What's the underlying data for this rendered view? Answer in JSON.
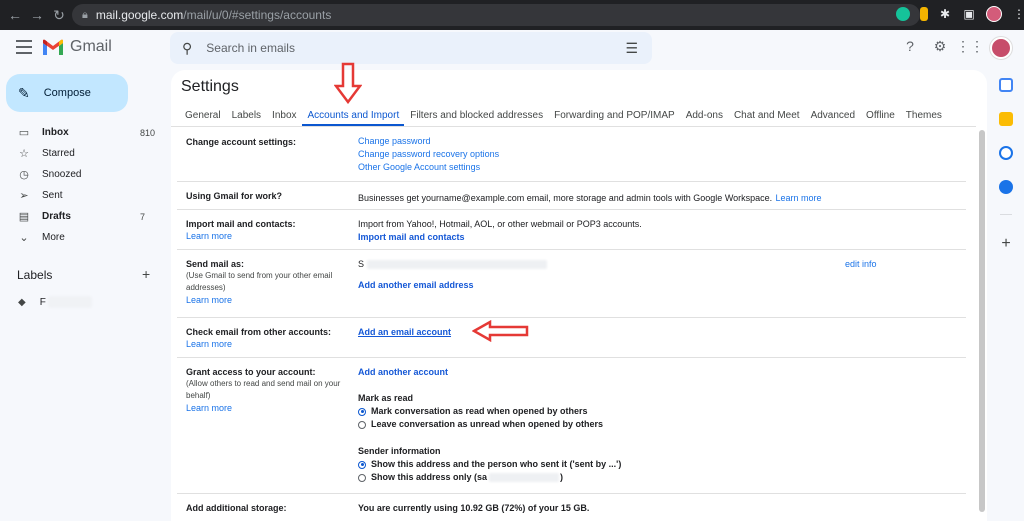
{
  "browser": {
    "url_host": "mail.google.com",
    "url_path": "/mail/u/0/#settings/accounts"
  },
  "app": {
    "name": "Gmail",
    "search_placeholder": "Search in emails"
  },
  "compose_label": "Compose",
  "nav": [
    {
      "label": "Inbox",
      "icon": "inbox-icon",
      "count": "810",
      "bold": true
    },
    {
      "label": "Starred",
      "icon": "star-icon",
      "count": ""
    },
    {
      "label": "Snoozed",
      "icon": "clock-icon",
      "count": ""
    },
    {
      "label": "Sent",
      "icon": "send-icon",
      "count": ""
    },
    {
      "label": "Drafts",
      "icon": "draft-icon",
      "count": "7",
      "bold": true
    },
    {
      "label": "More",
      "icon": "chevron-down-icon",
      "count": ""
    }
  ],
  "labels_header": "Labels",
  "label_item": "F",
  "settings": {
    "title": "Settings",
    "tabs": [
      "General",
      "Labels",
      "Inbox",
      "Accounts and Import",
      "Filters and blocked addresses",
      "Forwarding and POP/IMAP",
      "Add-ons",
      "Chat and Meet",
      "Advanced",
      "Offline",
      "Themes"
    ],
    "active_tab": "Accounts and Import",
    "rows": {
      "change_account": {
        "title": "Change account settings:",
        "links": [
          "Change password",
          "Change password recovery options",
          "Other Google Account settings"
        ]
      },
      "work": {
        "title": "Using Gmail for work?",
        "text": "Businesses get yourname@example.com email, more storage and admin tools with Google Workspace.",
        "link": "Learn more"
      },
      "import": {
        "title": "Import mail and contacts:",
        "learn": "Learn more",
        "text": "Import from Yahoo!, Hotmail, AOL, or other webmail or POP3 accounts.",
        "link": "Import mail and contacts"
      },
      "send_as": {
        "title": "Send mail as:",
        "sub": "(Use Gmail to send from your other email addresses)",
        "learn": "Learn more",
        "address_initial": "S",
        "edit": "edit info",
        "link": "Add another email address"
      },
      "check_email": {
        "title": "Check email from other accounts:",
        "learn": "Learn more",
        "link": "Add an email account"
      },
      "grant": {
        "title": "Grant access to your account:",
        "sub": "(Allow others to read and send mail on your behalf)",
        "learn": "Learn more",
        "link": "Add another account",
        "mark_as_read": "Mark as read",
        "mark_opt1": "Mark conversation as read when opened by others",
        "mark_opt2": "Leave conversation as unread when opened by others",
        "sender_info": "Sender information",
        "sender_opt1": "Show this address and the person who sent it ('sent by ...')",
        "sender_opt2_start": "Show this address only (sa",
        "sender_opt2_end": ")"
      },
      "storage": {
        "title": "Add additional storage:",
        "text": "You are currently using 10.92 GB (72%) of your 15 GB."
      }
    }
  },
  "colors": {
    "accent": "#0b57d0",
    "link": "#1a73e8",
    "annotation": "#e53935",
    "compose_bg": "#c2e7ff"
  }
}
